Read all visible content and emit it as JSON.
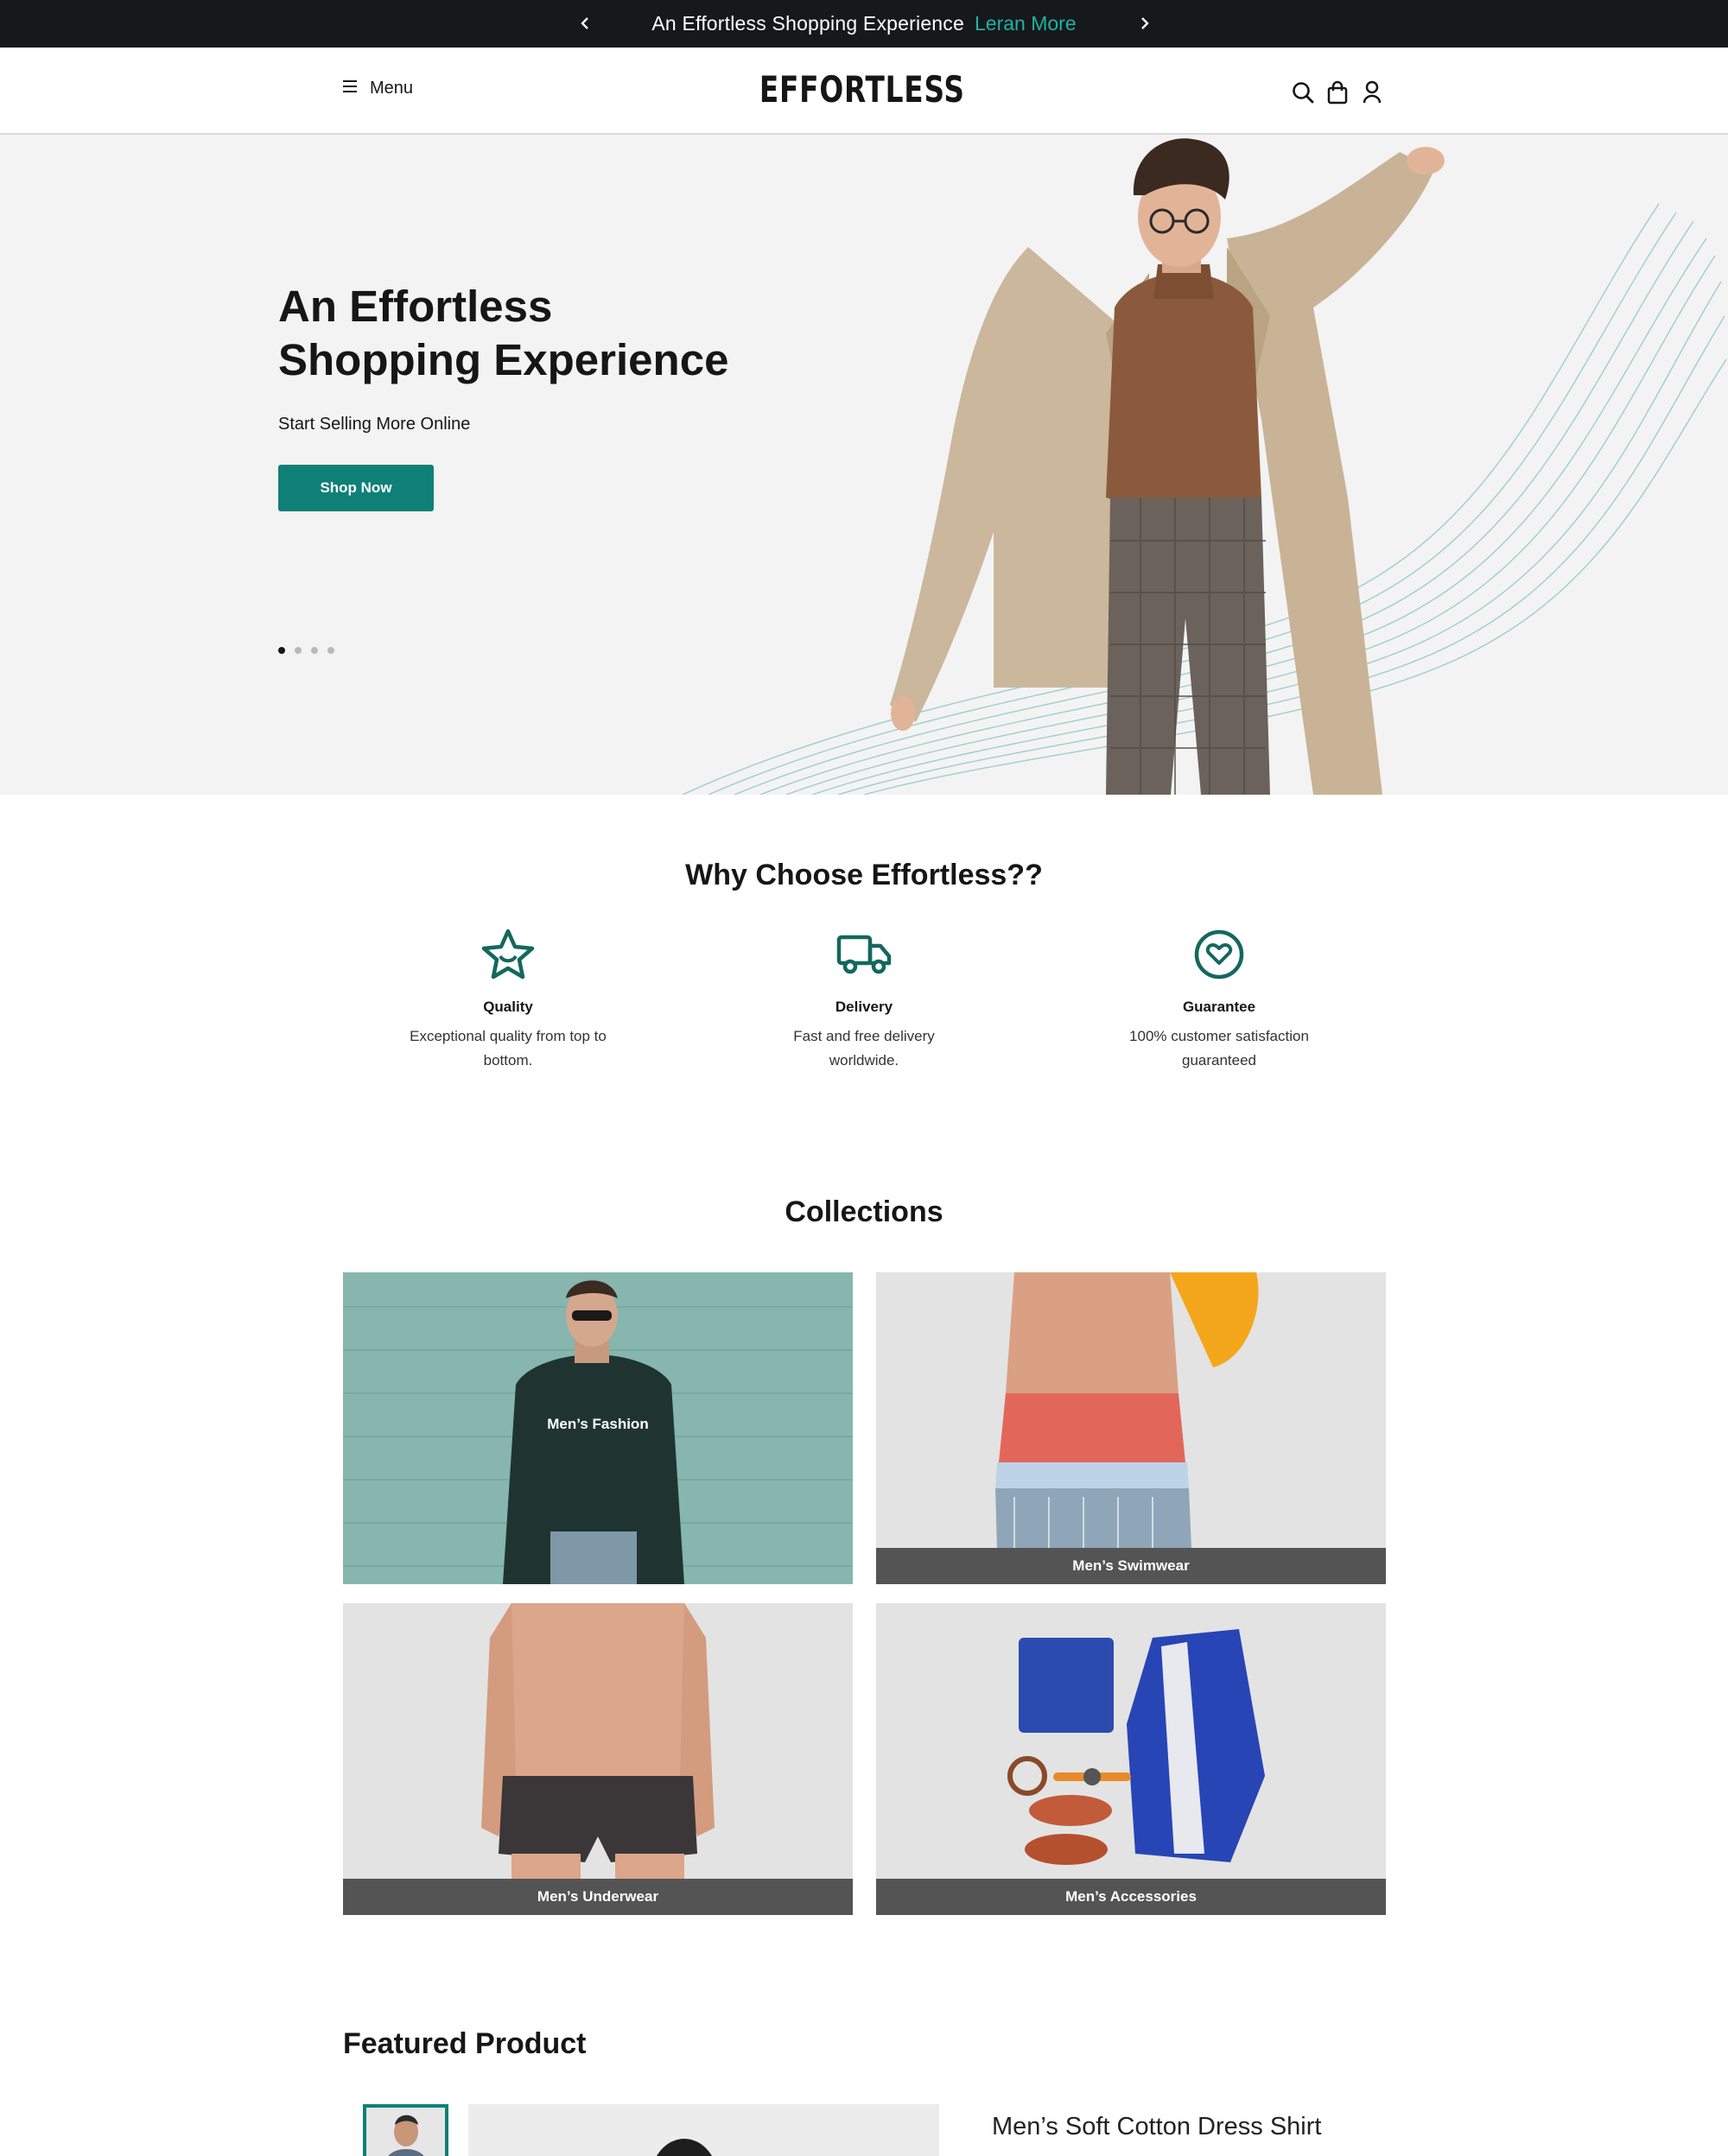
{
  "announcement": {
    "message": "An Effortless Shopping Experience",
    "link_label": "Leran More",
    "link_color": "#1fb3a1",
    "icons": [
      "chevron-left-icon",
      "chevron-right-icon"
    ]
  },
  "header": {
    "menu_label": "Menu",
    "logo": "EFFORTLESS",
    "icons": [
      "search-icon",
      "bag-icon",
      "user-icon"
    ]
  },
  "hero": {
    "title_line1": "An Effortless",
    "title_line2": "Shopping Experience",
    "subtitle": "Start Selling More Online",
    "cta_label": "Shop Now",
    "accent_color": "#0f8077",
    "slide_count": 4,
    "active_slide": 1
  },
  "why": {
    "title": "Why Choose Effortless??",
    "features": [
      {
        "icon": "star-icon",
        "title": "Quality",
        "line1": "Exceptional quality from top to",
        "line2": "bottom."
      },
      {
        "icon": "truck-icon",
        "title": "Delivery",
        "line1": "Fast and free delivery",
        "line2": "worldwide."
      },
      {
        "icon": "heart-badge-icon",
        "title": "Guarantee",
        "line1": "100% customer satisfaction",
        "line2": "guaranteed"
      }
    ]
  },
  "collections": {
    "title": "Collections",
    "items": [
      {
        "label": "Men’s Fashion"
      },
      {
        "label": "Men’s Swimwear"
      },
      {
        "label": "Men’s Underwear"
      },
      {
        "label": "Men’s Accessories"
      }
    ]
  },
  "featured": {
    "title": "Featured Product",
    "product_name": "Men’s Soft Cotton Dress Shirt"
  }
}
